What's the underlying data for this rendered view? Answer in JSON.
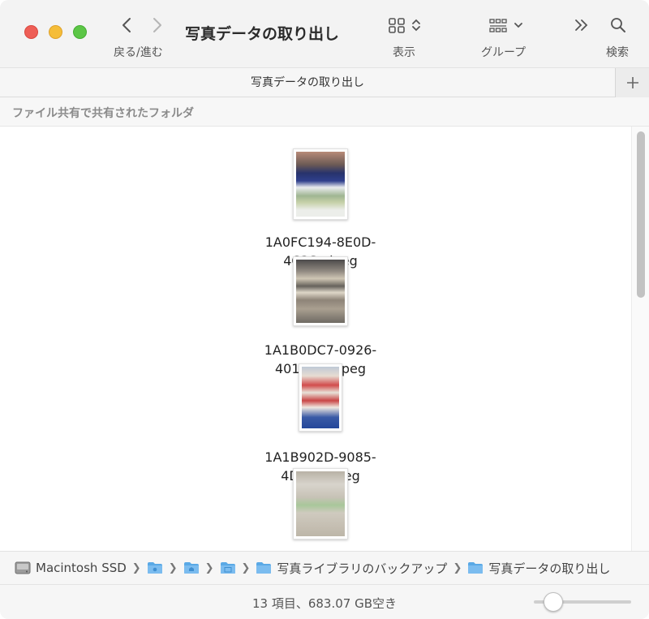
{
  "toolbar": {
    "title": "写真データの取り出し",
    "nav_label": "戻る/進む",
    "view_label": "表示",
    "group_label": "グループ",
    "search_label": "検索"
  },
  "tab": {
    "title": "写真データの取り出し"
  },
  "section": {
    "header": "ファイル共有で共有されたフォルダ"
  },
  "files": [
    {
      "name": "1A0FC194-8E0D-4C3S...jpeg"
    },
    {
      "name": "1A1B0DC7-0926-401E-...A.jpeg"
    },
    {
      "name": "1A1B902D-9085-4DF5-...jpeg"
    },
    {
      "name": ""
    }
  ],
  "pathbar": {
    "disk": "Macintosh SSD",
    "folder1": "写真ライブラリのバックアップ",
    "folder2": "写真データの取り出し"
  },
  "status": {
    "text": "13 項目、683.07 GB空き"
  },
  "zoom_slider": {
    "value": 0.2
  },
  "colors": {
    "folder": "#5aa9e6",
    "accent": "#2b2b2b"
  }
}
